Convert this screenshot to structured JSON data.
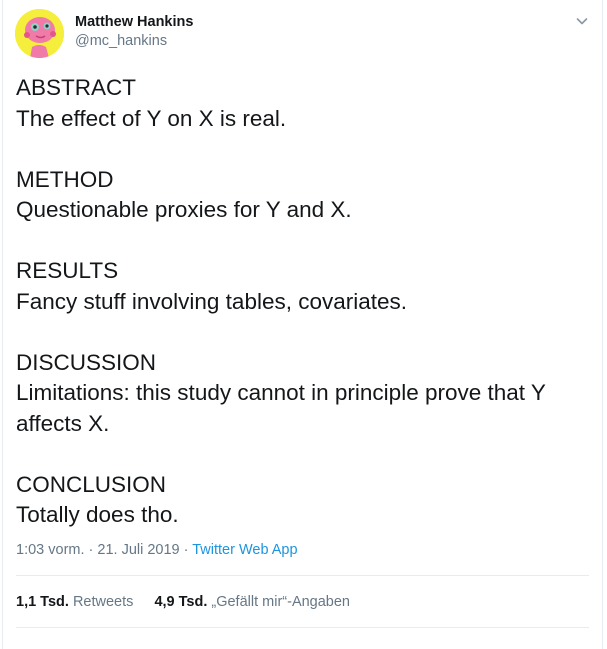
{
  "user": {
    "display_name": "Matthew Hankins",
    "screen_name": "@mc_hankins",
    "avatar_icon": "avatar-face-icon"
  },
  "tweet": {
    "sections": [
      {
        "heading": "ABSTRACT",
        "lines": [
          "The effect of Y on X is real."
        ]
      },
      {
        "heading": "METHOD",
        "lines": [
          "Questionable proxies for Y and X."
        ]
      },
      {
        "heading": "RESULTS",
        "lines": [
          "Fancy stuff involving tables, covariates."
        ]
      },
      {
        "heading": "DISCUSSION",
        "lines": [
          "Limitations: this study cannot in principle prove that Y",
          "affects X."
        ]
      },
      {
        "heading": "CONCLUSION",
        "lines": [
          "Totally does tho."
        ]
      }
    ]
  },
  "meta": {
    "time": "1:03 vorm.",
    "separator": " · ",
    "date": "21. Juli 2019",
    "source": "Twitter Web App"
  },
  "stats": {
    "retweets_count": "1,1 Tsd.",
    "retweets_label": "Retweets",
    "likes_count": "4,9 Tsd.",
    "likes_label": "„Gefällt mir“-Angaben"
  },
  "colors": {
    "link": "#1b95e0",
    "secondary_text": "#657786",
    "primary_text": "#14171a",
    "divider": "#e6ecf0"
  }
}
